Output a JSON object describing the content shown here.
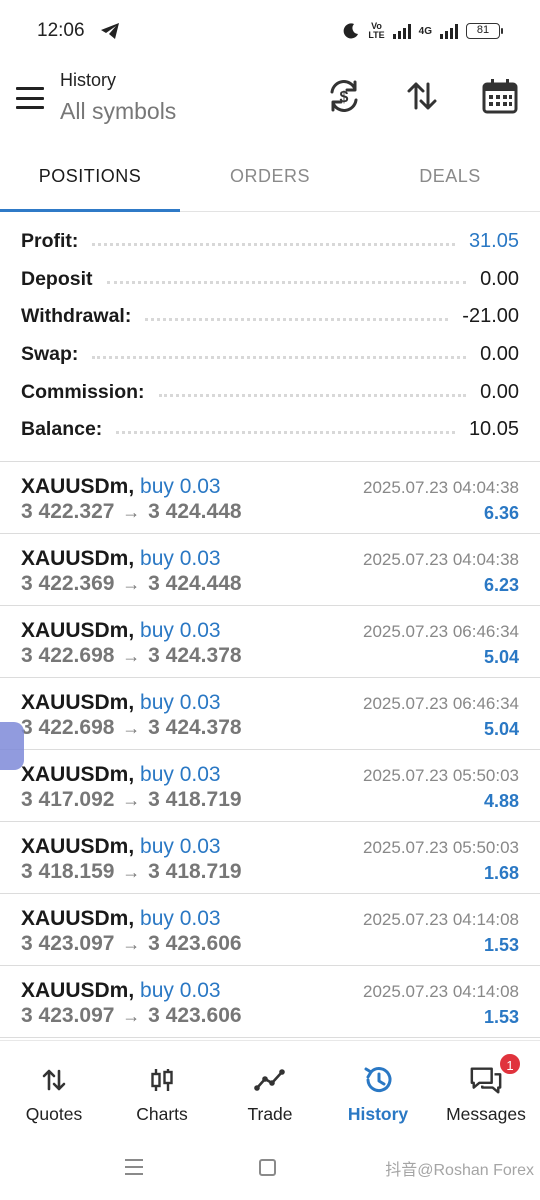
{
  "status_bar": {
    "time": "12:06",
    "battery": "81",
    "network": "4G",
    "volte": "Vo\nLTE"
  },
  "header": {
    "title": "History",
    "subtitle": "All symbols"
  },
  "tabs": [
    {
      "label": "POSITIONS",
      "active": true
    },
    {
      "label": "ORDERS",
      "active": false
    },
    {
      "label": "DEALS",
      "active": false
    }
  ],
  "summary": [
    {
      "label": "Profit:",
      "value": "31.05"
    },
    {
      "label": "Deposit",
      "value": "0.00"
    },
    {
      "label": "Withdrawal:",
      "value": "-21.00"
    },
    {
      "label": "Swap:",
      "value": "0.00"
    },
    {
      "label": "Commission:",
      "value": "0.00"
    },
    {
      "label": "Balance:",
      "value": "10.05"
    }
  ],
  "trades": [
    {
      "symbol": "XAUUSDm,",
      "side": "buy 0.03",
      "open": "3 422.327",
      "close": "3 424.448",
      "time": "2025.07.23 04:04:38",
      "pnl": "6.36"
    },
    {
      "symbol": "XAUUSDm,",
      "side": "buy 0.03",
      "open": "3 422.369",
      "close": "3 424.448",
      "time": "2025.07.23 04:04:38",
      "pnl": "6.23"
    },
    {
      "symbol": "XAUUSDm,",
      "side": "buy 0.03",
      "open": "3 422.698",
      "close": "3 424.378",
      "time": "2025.07.23 06:46:34",
      "pnl": "5.04"
    },
    {
      "symbol": "XAUUSDm,",
      "side": "buy 0.03",
      "open": "3 422.698",
      "close": "3 424.378",
      "time": "2025.07.23 06:46:34",
      "pnl": "5.04"
    },
    {
      "symbol": "XAUUSDm,",
      "side": "buy 0.03",
      "open": "3 417.092",
      "close": "3 418.719",
      "time": "2025.07.23 05:50:03",
      "pnl": "4.88"
    },
    {
      "symbol": "XAUUSDm,",
      "side": "buy 0.03",
      "open": "3 418.159",
      "close": "3 418.719",
      "time": "2025.07.23 05:50:03",
      "pnl": "1.68"
    },
    {
      "symbol": "XAUUSDm,",
      "side": "buy 0.03",
      "open": "3 423.097",
      "close": "3 423.606",
      "time": "2025.07.23 04:14:08",
      "pnl": "1.53"
    },
    {
      "symbol": "XAUUSDm,",
      "side": "buy 0.03",
      "open": "3 423.097",
      "close": "3 423.606",
      "time": "2025.07.23 04:14:08",
      "pnl": "1.53"
    }
  ],
  "trade_arrow": "→",
  "bottom_nav": [
    {
      "label": "Quotes",
      "icon": "quotes-icon",
      "active": false
    },
    {
      "label": "Charts",
      "icon": "charts-icon",
      "active": false
    },
    {
      "label": "Trade",
      "icon": "trade-icon",
      "active": false
    },
    {
      "label": "History",
      "icon": "history-icon",
      "active": true
    },
    {
      "label": "Messages",
      "icon": "messages-icon",
      "active": false,
      "badge": "1"
    }
  ],
  "watermark": "抖音@Roshan Forex",
  "colors": {
    "accent_blue": "#2a78c4",
    "badge_red": "#e0333d",
    "muted_text": "#777777"
  }
}
